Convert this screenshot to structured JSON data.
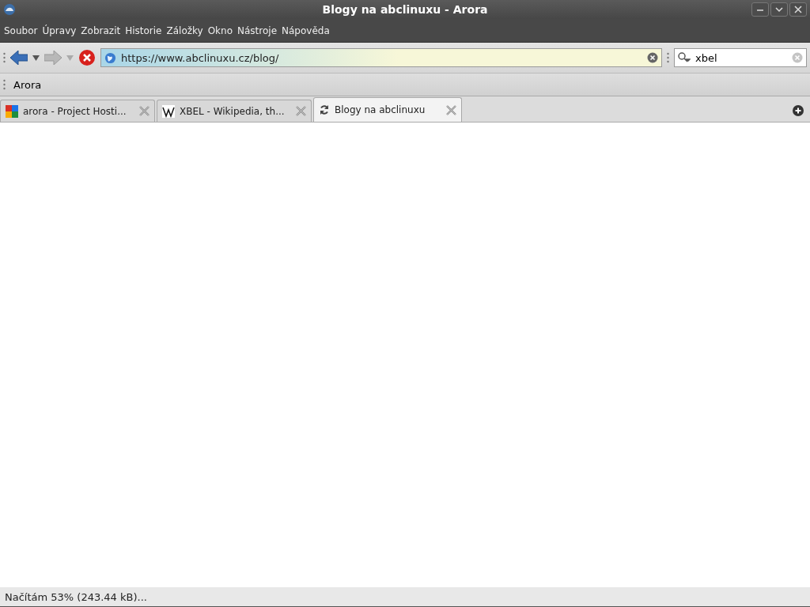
{
  "window": {
    "title": "Blogy na abclinuxu - Arora"
  },
  "menu": [
    "Soubor",
    "Úpravy",
    "Zobrazit",
    "Historie",
    "Záložky",
    "Okno",
    "Nástroje",
    "Nápověda"
  ],
  "navigation": {
    "back_disabled": false,
    "forward_disabled": true
  },
  "url_bar": {
    "value": "https://www.abclinuxu.cz/blog/",
    "level": 0.53
  },
  "search": {
    "value": "xbel"
  },
  "bookmarks": [
    "Arora"
  ],
  "tabs": [
    {
      "label": "arora - Project Hosti...",
      "kind": "google",
      "selected": false,
      "loading": false
    },
    {
      "label": "XBEL - Wikipedia, th...",
      "kind": "wiki",
      "selected": false,
      "loading": false
    },
    {
      "label": "Blogy na abclinuxu",
      "selected": true,
      "loading": true
    }
  ],
  "status_bar": {
    "text": "Načítám 53% (243.44 kB)..."
  }
}
